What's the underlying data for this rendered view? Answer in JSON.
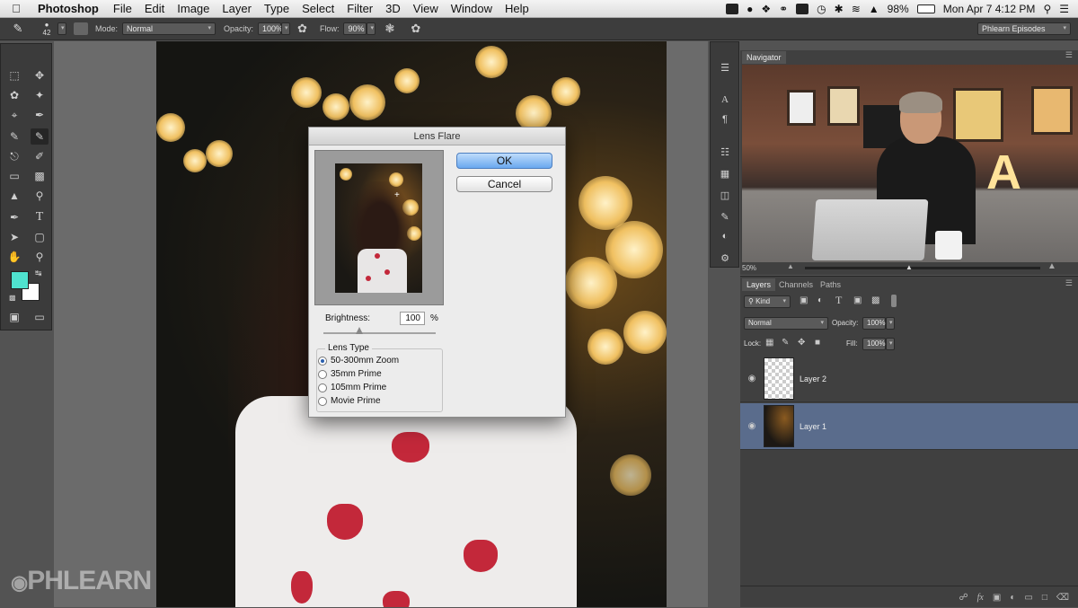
{
  "menubar": {
    "app_name": "Photoshop",
    "menus": [
      "File",
      "Edit",
      "Image",
      "Layer",
      "Type",
      "Select",
      "Filter",
      "3D",
      "View",
      "Window",
      "Help"
    ],
    "battery": "98%",
    "datetime": "Mon Apr 7   4:12 PM"
  },
  "options": {
    "brush_size": "42",
    "mode_label": "Mode:",
    "mode_value": "Normal",
    "opacity_label": "Opacity:",
    "opacity_value": "100%",
    "flow_label": "Flow:",
    "flow_value": "90%",
    "workspace": "Phlearn Episodes"
  },
  "dialog": {
    "title": "Lens Flare",
    "ok_label": "OK",
    "cancel_label": "Cancel",
    "brightness_label": "Brightness:",
    "brightness_value": "100",
    "brightness_unit": "%",
    "lens_type_label": "Lens Type",
    "lens_options": [
      "50-300mm Zoom",
      "35mm Prime",
      "105mm Prime",
      "Movie Prime"
    ],
    "selected_lens": "50-300mm Zoom"
  },
  "navigator": {
    "tab_label": "Navigator",
    "zoom": "50%"
  },
  "layers_panel": {
    "tabs": [
      "Layers",
      "Channels",
      "Paths"
    ],
    "kind_label": "Kind",
    "blend_mode": "Normal",
    "opacity_label": "Opacity:",
    "opacity_value": "100%",
    "lock_label": "Lock:",
    "fill_label": "Fill:",
    "fill_value": "100%",
    "layers": [
      {
        "name": "Layer 2",
        "selected": false
      },
      {
        "name": "Layer 1",
        "selected": true
      }
    ]
  },
  "watermark": "PHLEARN",
  "colors": {
    "foreground": "#4fe3cf",
    "background": "#ffffff",
    "selected_layer": "#5a6c8c",
    "ok_button": "#6aa8ef"
  }
}
